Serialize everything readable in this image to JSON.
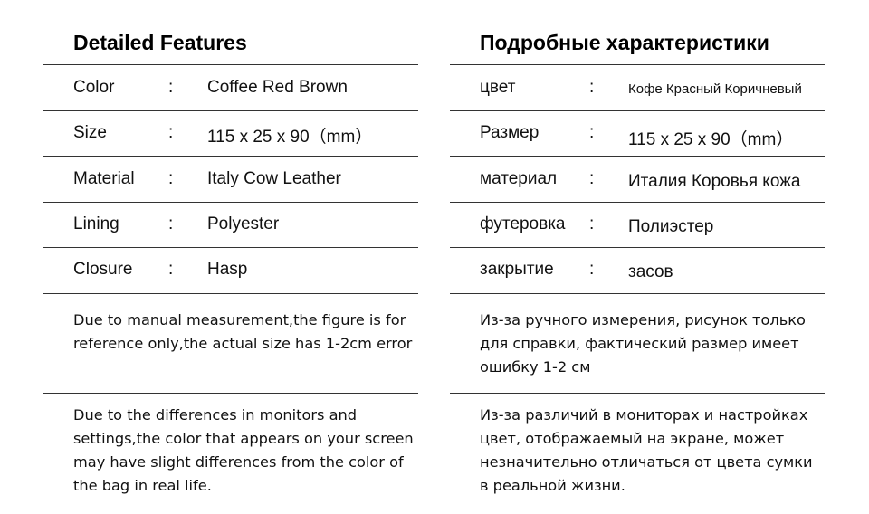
{
  "left": {
    "title": "Detailed Features",
    "rows": [
      {
        "label": "Color",
        "sep": ":",
        "value": "Coffee  Red  Brown"
      },
      {
        "label": "Size",
        "sep": ":",
        "value": "115 x 25 x 90（mm）"
      },
      {
        "label": "Material",
        "sep": ":",
        "value": "Italy Cow Leather"
      },
      {
        "label": "Lining",
        "sep": ":",
        "value": "Polyester"
      },
      {
        "label": "Closure",
        "sep": ":",
        "value": "Hasp"
      }
    ],
    "notes": [
      "Due to manual measurement,the figure is for reference only,the actual size has 1-2cm error",
      "Due to the differences in monitors and settings,the color that appears on your screen may have slight differences from the color of the bag in real life."
    ]
  },
  "right": {
    "title": "Подробные характеристики",
    "rows": [
      {
        "label": "цвет",
        "sep": ":",
        "value": "Кофе Красный Коричневый"
      },
      {
        "label": "Размер",
        "sep": ":",
        "value": "115 x 25 x 90（mm）"
      },
      {
        "label": "материал",
        "sep": ":",
        "value": "Италия Коровья кожа"
      },
      {
        "label": "футеровка",
        "sep": ":",
        "value": "Полиэстер"
      },
      {
        "label": "закрытие",
        "sep": ":",
        "value": "засов"
      }
    ],
    "notes": [
      "Из-за ручного измерения, рисунок только для справки, фактический размер имеет ошибку 1-2 см",
      "Из-за различий в мониторах и настройках цвет, отображаемый на экране, может незначительно отличаться от цвета сумки в реальной жизни."
    ]
  }
}
